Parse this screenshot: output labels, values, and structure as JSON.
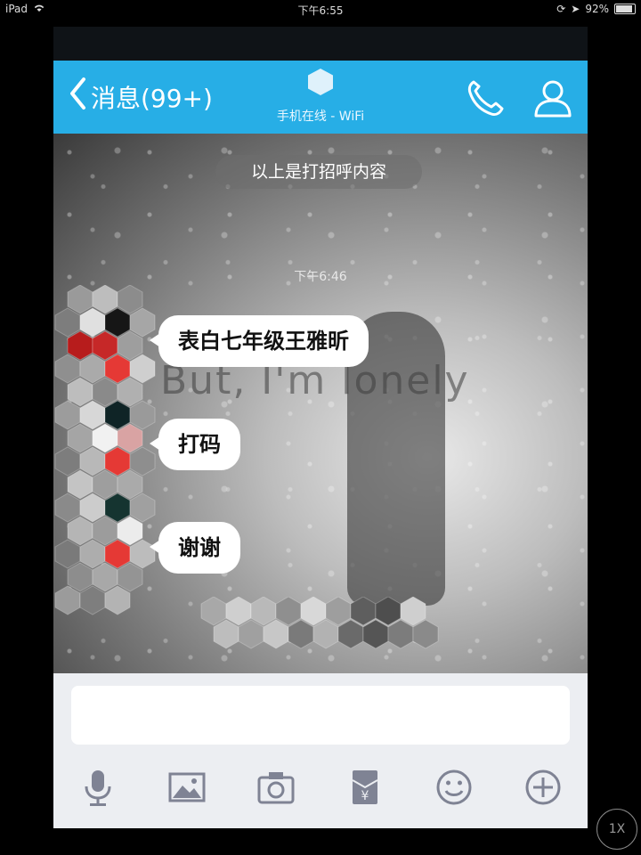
{
  "status_bar": {
    "device": "iPad",
    "time": "下午6:55",
    "battery": "92%"
  },
  "nav": {
    "back_label": "消息(99+)",
    "subtitle": "手机在线 - WiFi"
  },
  "chat": {
    "greeting": "以上是打招呼内容",
    "timestamp": "下午6:46",
    "window_text": "But, I'm lonely",
    "messages": [
      {
        "text": "表白七年级王雅昕"
      },
      {
        "text": "打码"
      },
      {
        "text": "谢谢"
      }
    ]
  },
  "input": {
    "value": ""
  },
  "toolbar": {
    "icons": [
      "microphone-icon",
      "image-icon",
      "camera-icon",
      "red-packet-icon",
      "emoji-icon",
      "add-icon"
    ]
  },
  "zoom_badge": "1X",
  "colors": {
    "nav_bg": "#27aee6",
    "input_bg": "#eceef2",
    "icon_gray": "#7f8394",
    "mosaic_red": "#e53935"
  }
}
